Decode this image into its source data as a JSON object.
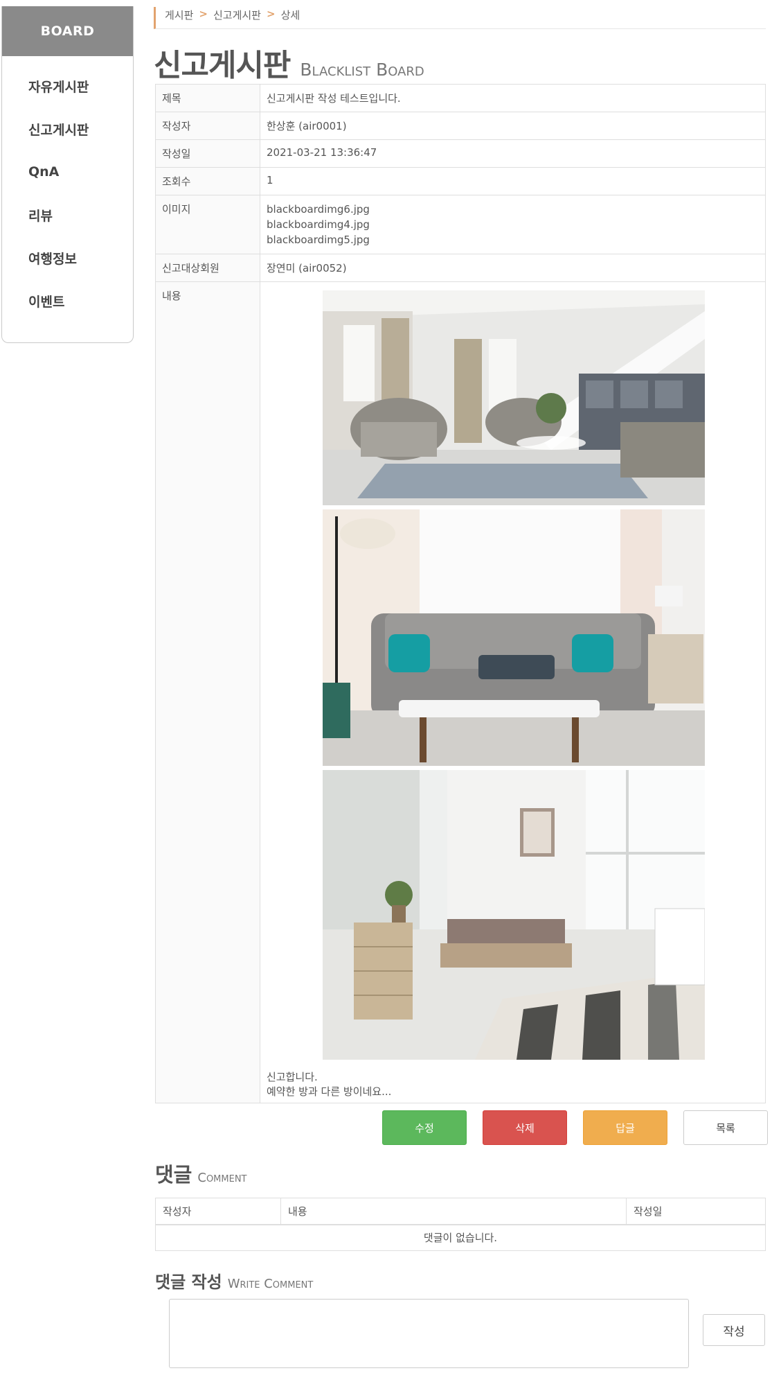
{
  "sidebar": {
    "title": "BOARD",
    "items": [
      {
        "label": "자유게시판"
      },
      {
        "label": "신고게시판"
      },
      {
        "label": "QnA"
      },
      {
        "label": "리뷰"
      },
      {
        "label": "여행정보"
      },
      {
        "label": "이벤트"
      }
    ]
  },
  "breadcrumb": [
    "게시판",
    "신고게시판",
    "상세"
  ],
  "page_title": {
    "ko": "신고게시판",
    "en": "Blacklist Board"
  },
  "post": {
    "labels": {
      "title": "제목",
      "writer": "작성자",
      "date": "작성일",
      "views": "조회수",
      "images": "이미지",
      "reported": "신고대상회원",
      "content": "내용"
    },
    "title": "신고게시판 작성 테스트입니다.",
    "writer": "한상훈 (air0001)",
    "date": "2021-03-21 13:36:47",
    "views": "1",
    "images": [
      "blackboardimg6.jpg",
      "blackboardimg4.jpg",
      "blackboardimg5.jpg"
    ],
    "reported_member": "장연미 (air0052)",
    "content_lines": [
      "신고합니다.",
      "예약한 방과 다른 방이네요..."
    ]
  },
  "buttons": {
    "edit": "수정",
    "delete": "삭제",
    "reply": "답글",
    "list": "목록"
  },
  "comments": {
    "title_ko": "댓글",
    "title_en": "Comment",
    "columns": [
      "작성자",
      "내용",
      "작성일"
    ],
    "empty": "댓글이 없습니다."
  },
  "write_comment": {
    "title_ko": "댓글 작성",
    "title_en": "Write Comment",
    "submit": "작성"
  }
}
